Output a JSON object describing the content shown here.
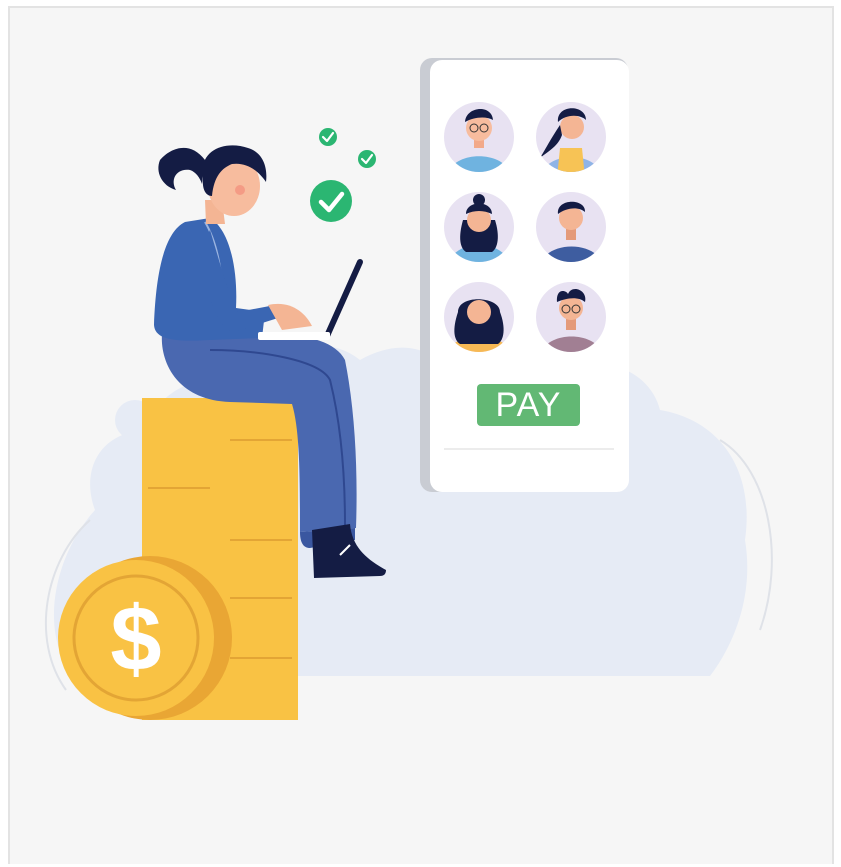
{
  "illustration": {
    "scene": "woman-with-laptop-paying",
    "pay_label": "PAY",
    "avatars": [
      "man-glasses-blue",
      "woman-ponytail-yellow",
      "woman-bun-blue",
      "man-dark-navy",
      "woman-long-hair-orange",
      "man-glasses-mauve"
    ],
    "colors": {
      "background": "#f6f6f6",
      "cloud": "#e6ebf5",
      "phone": "#ffffff",
      "phone_edge": "#c9ccd3",
      "pay_button": "#62b874",
      "coin": "#f9c244",
      "coin_shadow": "#e9a634",
      "check": "#2bb672",
      "shirt": "#3a66b3",
      "pants": "#4a68b0",
      "hair": "#141c44"
    }
  }
}
